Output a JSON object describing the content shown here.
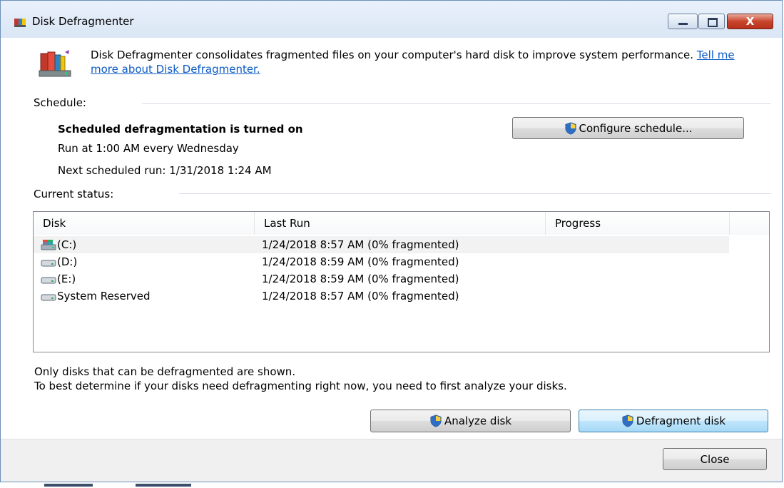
{
  "window": {
    "title": "Disk Defragmenter",
    "close_glyph": "X",
    "icons": {
      "app": "disk-defrag-icon",
      "minimize": "minimize-icon",
      "maximize": "maximize-icon",
      "close": "close-icon"
    }
  },
  "header": {
    "description": "Disk Defragmenter consolidates fragmented files on your computer's hard disk to improve system performance.",
    "link": "Tell me more about Disk Defragmenter."
  },
  "schedule": {
    "label": "Schedule:",
    "status": "Scheduled defragmentation is turned on",
    "run_at": "Run at 1:00 AM every Wednesday",
    "next_run": "Next scheduled run: 1/31/2018 1:24 AM",
    "configure_button": "Configure schedule..."
  },
  "status": {
    "label": "Current status:",
    "columns": [
      "Disk",
      "Last Run",
      "Progress"
    ],
    "rows": [
      {
        "disk": "(C:)",
        "last_run": "1/24/2018 8:57 AM (0% fragmented)",
        "icon": "system-drive-icon",
        "selected": true
      },
      {
        "disk": "(D:)",
        "last_run": "1/24/2018 8:59 AM (0% fragmented)",
        "icon": "drive-icon",
        "selected": false
      },
      {
        "disk": "(E:)",
        "last_run": "1/24/2018 8:59 AM (0% fragmented)",
        "icon": "drive-icon",
        "selected": false
      },
      {
        "disk": "System Reserved",
        "last_run": "1/24/2018 8:57 AM (0% fragmented)",
        "icon": "drive-icon",
        "selected": false
      }
    ]
  },
  "notes": {
    "line1": "Only disks that can be defragmented are shown.",
    "line2": "To best determine if your disks need defragmenting right now, you need to first analyze your disks."
  },
  "actions": {
    "analyze": "Analyze disk",
    "defragment": "Defragment disk",
    "close": "Close"
  },
  "colors": {
    "link": "#0d5bc6",
    "title_bar": "#dae6f5",
    "focus_border": "#3c7fb1"
  }
}
